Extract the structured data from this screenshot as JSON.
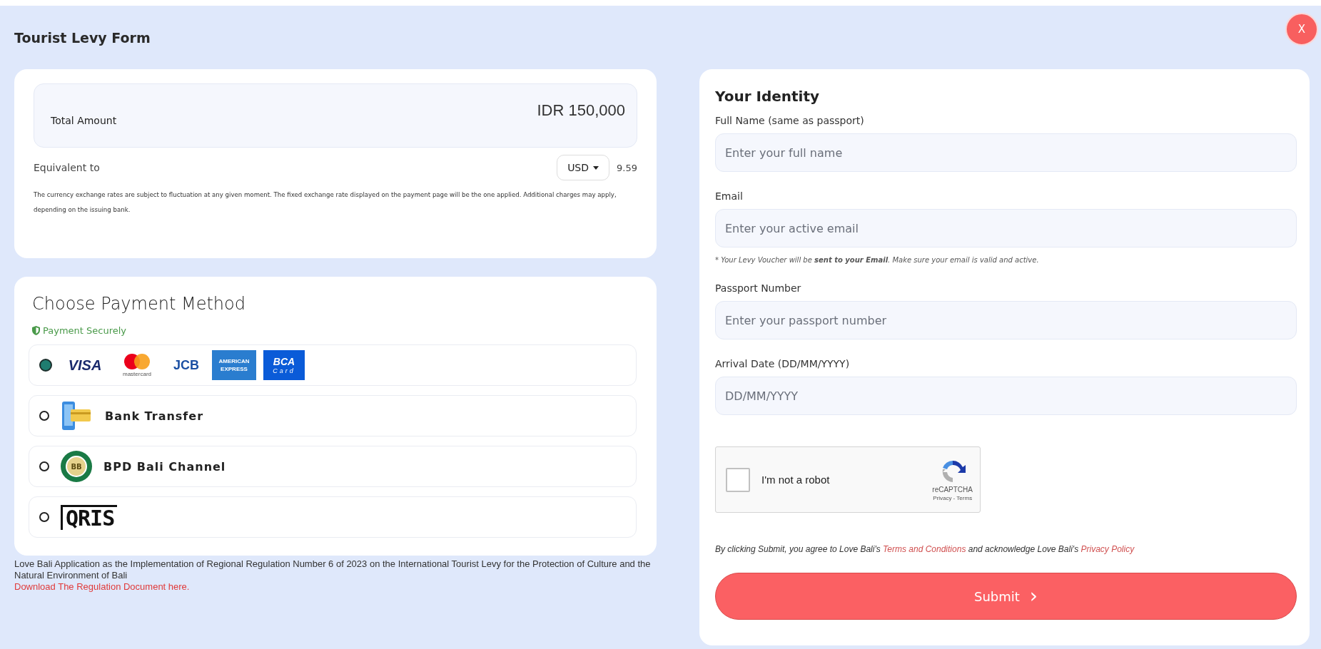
{
  "header": {
    "title": "Tourist Levy Form",
    "close_label": "X"
  },
  "amount": {
    "label": "Total Amount",
    "value": "IDR 150,000"
  },
  "equivalent": {
    "label": "Equivalent to",
    "currency": "USD",
    "value": "9.59"
  },
  "disclaimer": "The currency exchange rates are subject to fluctuation at any given moment. The fixed exchange rate displayed on the payment page will be the one applied. Additional charges may apply, depending on the issuing bank.",
  "payment": {
    "title": "Choose Payment Method",
    "secure_label": "Payment Securely",
    "methods": [
      {
        "kind": "cards",
        "selected": true,
        "logos": [
          "VISA",
          "mastercard",
          "JCB",
          "AMERICAN EXPRESS",
          "BCA",
          "Card"
        ]
      },
      {
        "kind": "bank",
        "selected": false,
        "label": "Bank Transfer"
      },
      {
        "kind": "bpd",
        "selected": false,
        "label": "BPD Bali Channel",
        "logo_text": "BB"
      },
      {
        "kind": "qris",
        "selected": false,
        "logo_text": "QRIS"
      }
    ]
  },
  "footer_note": {
    "text": "Love Bali Application as the Implementation of Regional Regulation Number 6 of 2023 on the International Tourist Levy for the Protection of Culture and the Natural Environment of Bali",
    "link": "Download The Regulation Document here."
  },
  "identity": {
    "title": "Your Identity",
    "fields": [
      {
        "label": "Full Name (same as passport)",
        "placeholder": "Enter your full name"
      },
      {
        "label": "Email",
        "placeholder": "Enter your active email",
        "note": "* Your Levy Voucher will be **sent to your Email**. Make sure your email is valid and active."
      },
      {
        "label": "Passport Number",
        "placeholder": "Enter your passport number"
      },
      {
        "label": "Arrival Date (DD/MM/YYYY)",
        "placeholder": "DD/MM/YYYY"
      }
    ]
  },
  "captcha": {
    "checked": false,
    "label": "I'm not a robot",
    "brand": "reCAPTCHA",
    "links": "Privacy - Terms"
  },
  "consent": {
    "before": "By clicking Submit, you agree to Love Bali's",
    "terms_link": "Terms and Conditions",
    "middle": "and acknowledge Love Bali's",
    "privacy_link": "Privacy Policy"
  },
  "submit": {
    "label": "Submit",
    "arrow": "›"
  }
}
